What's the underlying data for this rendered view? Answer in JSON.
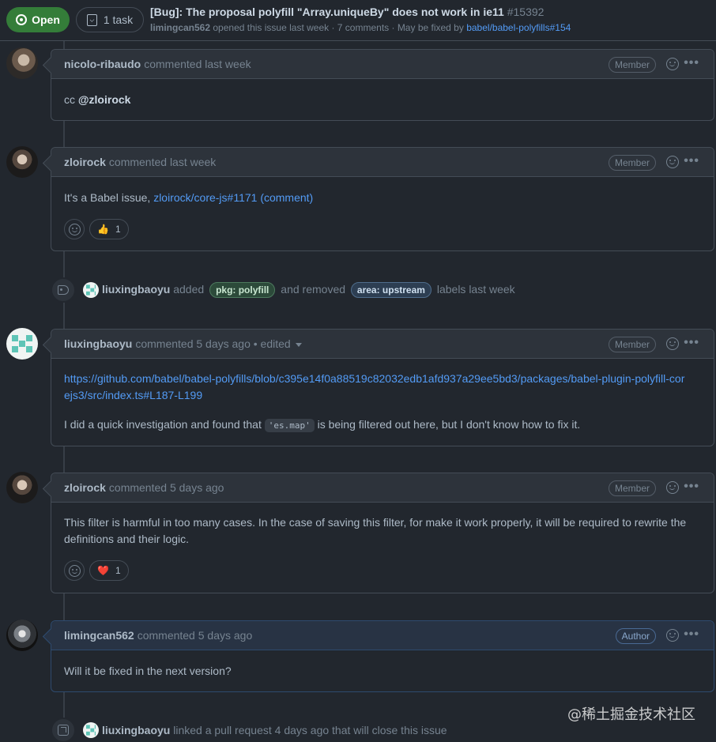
{
  "header": {
    "status_label": "Open",
    "tasks_label": "1 task",
    "title": "[Bug]: The proposal polyfill \"Array.uniqueBy\" does not work in ie11",
    "issue_number": "#15392",
    "opener": "limingcan562",
    "opened_text": "opened this issue last week · 7 comments · May be fixed by",
    "fix_link": "babel/babel-polyfills#154"
  },
  "comments": [
    {
      "author": "nicolo-ribaudo",
      "meta": "commented last week",
      "role": "Member",
      "body_prefix": "cc",
      "body_mention": "@zloirock"
    },
    {
      "author": "zloirock",
      "meta": "commented last week",
      "role": "Member",
      "body_prefix": "It's a Babel issue,",
      "body_link": "zloirock/core-js#1171 (comment)",
      "reaction_emoji": "👍",
      "reaction_count": "1"
    },
    {
      "author": "liuxingbaoyu",
      "meta": "commented 5 days ago • edited",
      "role": "Member",
      "body_link": "https://github.com/babel/babel-polyfills/blob/c395e14f0a88519c82032edb1afd937a29ee5bd3/packages/babel-plugin-polyfill-corejs3/src/index.ts#L187-L199",
      "body_text_before": "I did a quick investigation and found that",
      "body_code": "'es.map'",
      "body_text_after": "is being filtered out here, but I don't know how to fix it."
    },
    {
      "author": "zloirock",
      "meta": "commented 5 days ago",
      "role": "Member",
      "body_text": "This filter is harmful in too many cases. In the case of saving this filter, for make it work properly, it will be required to rewrite the definitions and their logic.",
      "reaction_emoji": "❤️",
      "reaction_count": "1"
    },
    {
      "author": "limingcan562",
      "meta": "commented 5 days ago",
      "role": "Author",
      "body_text": "Will it be fixed in the next version?"
    }
  ],
  "events": {
    "labels": {
      "actor": "liuxingbaoyu",
      "added_text": "added",
      "added_label": "pkg: polyfill",
      "added_color": "#c5def5",
      "removed_text": "and removed",
      "removed_label": "area: upstream",
      "removed_color": "#b3c7d9",
      "suffix": "labels last week"
    },
    "linked_pr": {
      "actor": "liuxingbaoyu",
      "text": "linked a pull request 4 days ago that will close this issue"
    }
  },
  "watermark": "@稀土掘金技术社区",
  "colors": {
    "open_green": "#347d39",
    "link_blue": "#539bf5",
    "background": "#22272e",
    "header_bg": "#2d333b"
  },
  "icons": [
    "issue-opened-icon",
    "checklist-icon",
    "tag-icon",
    "smiley-icon",
    "kebab-horizontal-icon",
    "cross-reference-icon",
    "triangle-down-icon"
  ]
}
